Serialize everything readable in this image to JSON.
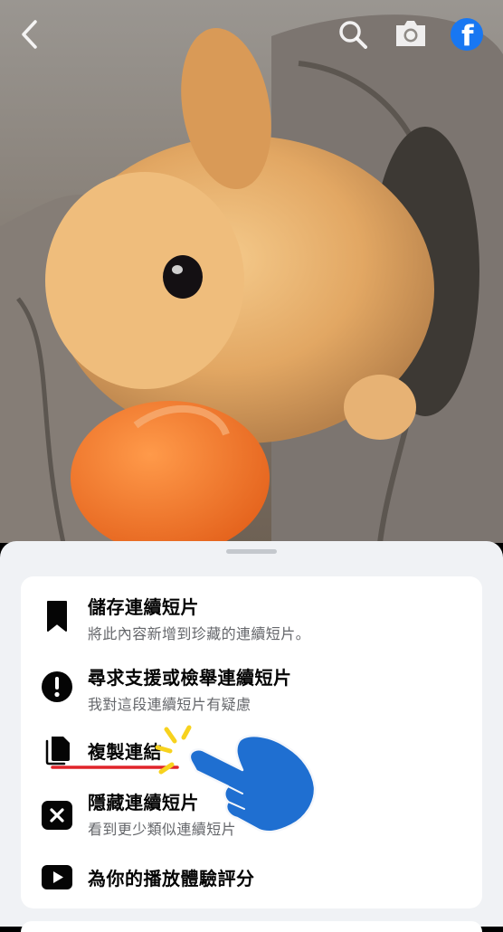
{
  "menu": {
    "save_title": "儲存連續短片",
    "save_subtitle": "將此內容新增到珍藏的連續短片。",
    "report_title": "尋求支援或檢舉連續短片",
    "report_subtitle": "我對這段連續短片有疑慮",
    "copy_title": "複製連結",
    "hide_title": "隱藏連續短片",
    "hide_subtitle": "看到更少類似連續短片",
    "rate_title": "為你的播放體驗評分"
  },
  "colors": {
    "facebook_blue": "#1877f2",
    "annotation_underline": "#e0242a",
    "pointer_hand": "#1f6fd1",
    "sparkle": "#f7d21e"
  },
  "icons": [
    "back-icon",
    "search-icon",
    "camera-icon",
    "facebook-logo-icon",
    "bookmark-icon",
    "exclamation-circle-icon",
    "copy-icon",
    "x-square-icon",
    "play-icon",
    "pointing-hand-icon"
  ]
}
